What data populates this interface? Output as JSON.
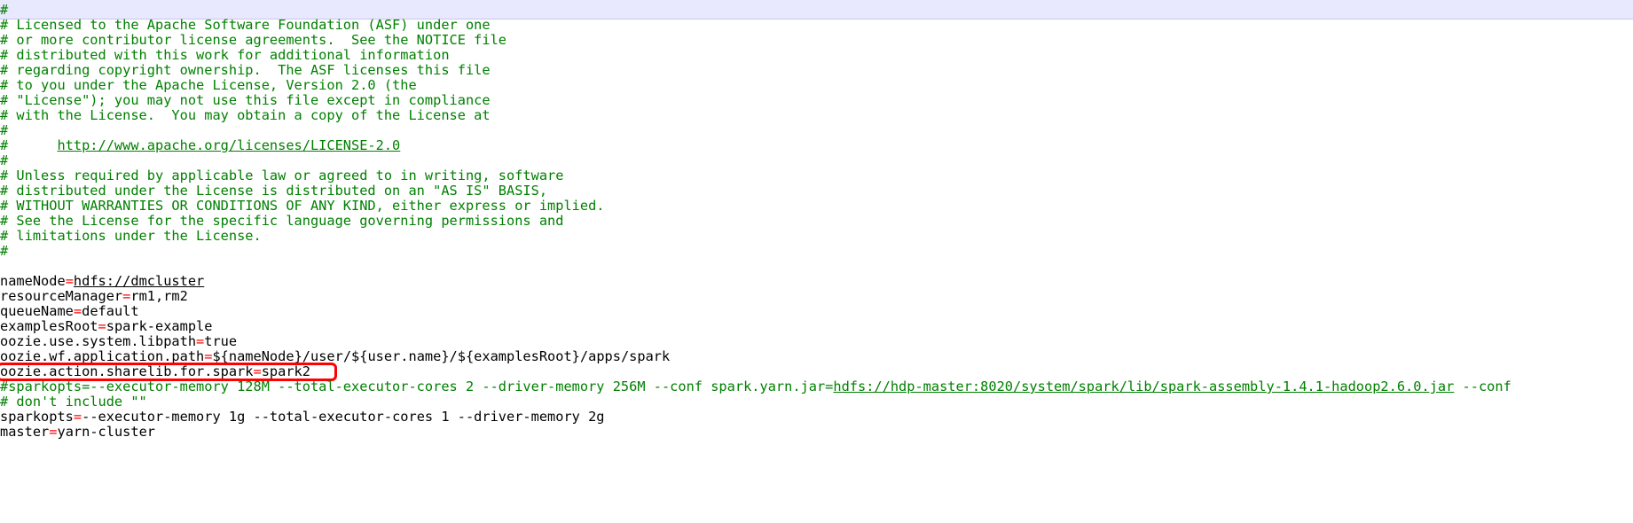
{
  "editor": {
    "license_lines": [
      "#",
      "# Licensed to the Apache Software Foundation (ASF) under one",
      "# or more contributor license agreements.  See the NOTICE file",
      "# distributed with this work for additional information",
      "# regarding copyright ownership.  The ASF licenses this file",
      "# to you under the Apache License, Version 2.0 (the",
      "# \"License\"); you may not use this file except in compliance",
      "# with the License.  You may obtain a copy of the License at",
      "#"
    ],
    "license_url_prefix": "#      ",
    "license_url": "http://www.apache.org/licenses/LICENSE-2.0",
    "disclaimer_lines": [
      "#",
      "# Unless required by applicable law or agreed to in writing, software",
      "# distributed under the License is distributed on an \"AS IS\" BASIS,",
      "# WITHOUT WARRANTIES OR CONDITIONS OF ANY KIND, either express or implied.",
      "# See the License for the specific language governing permissions and",
      "# limitations under the License.",
      "#"
    ],
    "properties": [
      {
        "key": "nameNode",
        "value": "hdfs://dmcluster",
        "link": true
      },
      {
        "key": "resourceManager",
        "value": "rm1,rm2",
        "link": false
      },
      {
        "key": "queueName",
        "value": "default",
        "link": false
      },
      {
        "key": "examplesRoot",
        "value": "spark-example",
        "link": false
      },
      {
        "key": "oozie.use.system.libpath",
        "value": "true",
        "link": false
      },
      {
        "key": "oozie.wf.application.path",
        "value": "${nameNode}/user/${user.name}/${examplesRoot}/apps/spark",
        "link": false
      },
      {
        "key": "oozie.action.sharelib.for.spark",
        "value": "spark2",
        "link": false,
        "highlighted": true
      }
    ],
    "commented_sparkopts": {
      "prefix": "#sparkopts=--executor-memory 128M --total-executor-cores 2 --driver-memory 256M --conf spark.yarn.jar=",
      "link": "hdfs://hdp-master:8020/system/spark/lib/spark-assembly-1.4.1-hadoop2.6.0.jar",
      "suffix": " --conf"
    },
    "dont_include_comment": "# don't include \"\"",
    "tail_properties": [
      {
        "key": "sparkopts",
        "value": "--executor-memory 1g --total-executor-cores 1 --driver-memory 2g"
      },
      {
        "key": "master",
        "value": "yarn-cluster"
      }
    ],
    "equals_sign": "=",
    "colors": {
      "comment": "#008000",
      "operator": "#ff0000",
      "highlight_box": "#ff0000",
      "current_line": "#e8e8ff"
    }
  }
}
